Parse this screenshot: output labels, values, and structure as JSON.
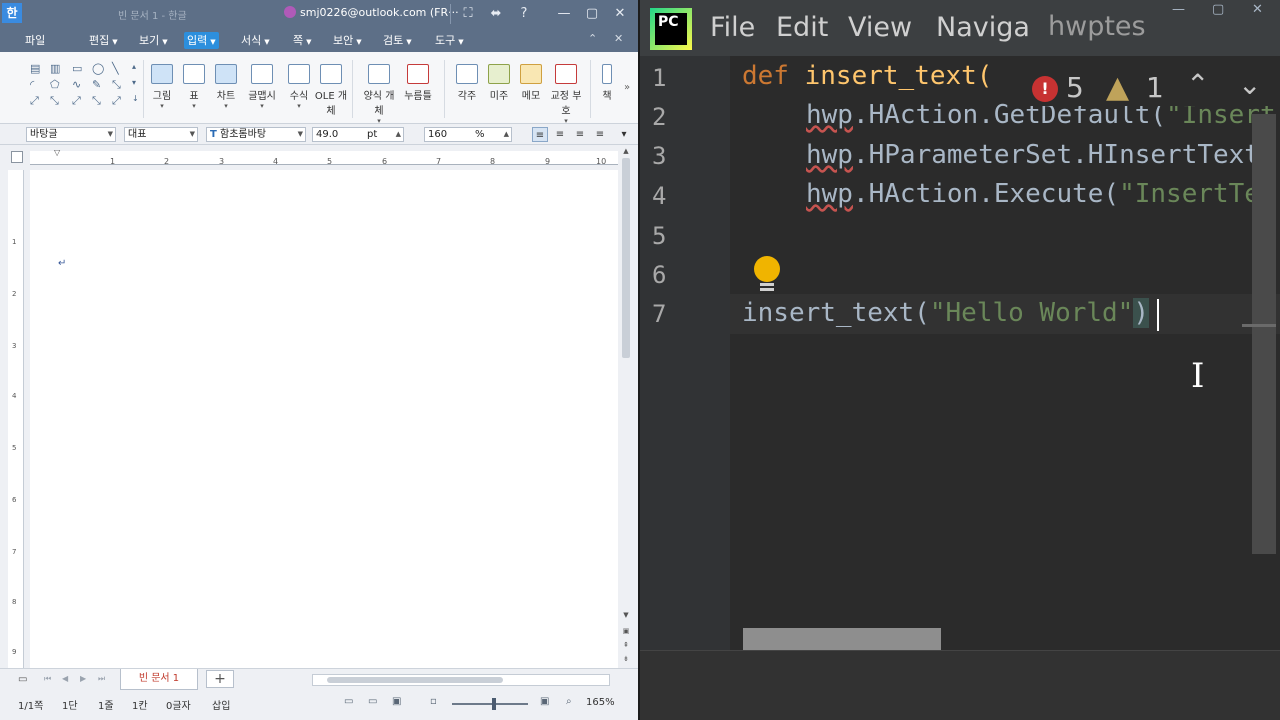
{
  "hwp": {
    "title": {
      "logo": "한",
      "document": "빈 문서 1 - 한글",
      "account": "smj0226@outlook.com (FR···",
      "controls": [
        "⛶",
        "⬌",
        "?",
        "—",
        "▢",
        "✕"
      ]
    },
    "menu": {
      "items": [
        {
          "label": "파일",
          "dropdown": false,
          "active": false
        },
        {
          "label": "편집",
          "dropdown": true,
          "active": false
        },
        {
          "label": "보기",
          "dropdown": true,
          "active": false
        },
        {
          "label": "입력",
          "dropdown": true,
          "active": true
        },
        {
          "label": "서식",
          "dropdown": true,
          "active": false
        },
        {
          "label": "쪽",
          "dropdown": true,
          "active": false
        },
        {
          "label": "보안",
          "dropdown": true,
          "active": false
        },
        {
          "label": "검토",
          "dropdown": true,
          "active": false
        },
        {
          "label": "도구",
          "dropdown": true,
          "active": false
        }
      ],
      "controls": [
        "⌃",
        "✕"
      ]
    },
    "ribbon": {
      "buttons": [
        {
          "label": "그림",
          "sub": "▾",
          "icon": "picture-icon"
        },
        {
          "label": "표",
          "sub": "▾",
          "icon": "table-icon"
        },
        {
          "label": "차트",
          "sub": "▾",
          "icon": "chart-icon"
        },
        {
          "label": "글맵시",
          "sub": "▾",
          "icon": "wordart-icon"
        },
        {
          "label": "수식",
          "sub": "▾",
          "icon": "equation-icon"
        },
        {
          "label": "OLE 개체",
          "sub": "",
          "icon": "ole-icon"
        },
        {
          "label": "양식 개체",
          "sub": "▾",
          "icon": "form-object-icon"
        },
        {
          "label": "누름틀",
          "sub": "",
          "icon": "field-icon"
        },
        {
          "label": "각주",
          "sub": "",
          "icon": "footnote-icon"
        },
        {
          "label": "미주",
          "sub": "",
          "icon": "endnote-icon"
        },
        {
          "label": "메모",
          "sub": "",
          "icon": "memo-icon"
        },
        {
          "label": "교정 부호",
          "sub": "▾",
          "icon": "proofread-icon"
        },
        {
          "label": "책",
          "sub": "",
          "icon": "book-icon"
        }
      ]
    },
    "format": {
      "style": "바탕글",
      "lang": "대표",
      "font": "함초롬바탕",
      "size": "49.0",
      "unit": "pt",
      "spacing": "160",
      "spacing_unit": "%"
    },
    "ruler_numbers": [
      "1",
      "2",
      "3",
      "4",
      "5",
      "6",
      "7",
      "8",
      "9",
      "10"
    ],
    "vruler_numbers": [
      "1",
      "2",
      "3",
      "4",
      "5",
      "6",
      "7",
      "8",
      "9"
    ],
    "page": {
      "para_mark": "↵"
    },
    "doc_tab": "빈 문서 1",
    "status": {
      "page": "1/1쪽",
      "section": "1단",
      "line": "1줄",
      "column": "1칸",
      "chars": "0글자",
      "mode": "삽입",
      "zoom": "165%"
    }
  },
  "pycharm": {
    "logo": "PC",
    "menu": [
      "File",
      "Edit",
      "View",
      "Naviga"
    ],
    "project": "hwptes",
    "window_controls": [
      "—",
      "▢",
      "✕"
    ],
    "indicators": {
      "errors": "5",
      "warnings": "1"
    },
    "line_numbers": [
      "1",
      "2",
      "3",
      "4",
      "5",
      "6",
      "7"
    ],
    "code": {
      "l1_kw": "def",
      "l1_fn": "insert_text(",
      "l2_pre": "hwp",
      "l2_mid": ".HAction.GetDefault(",
      "l2_str": "\"Insert",
      "l3_pre": "hwp",
      "l3_mid": ".HParameterSet.HInsertText.",
      "l4_pre": "hwp",
      "l4_mid": ".HAction.Execute(",
      "l4_str": "\"InsertTex",
      "l7_call": "insert_text(",
      "l7_str": "\"Hello World\"",
      "l7_close": ")"
    }
  }
}
